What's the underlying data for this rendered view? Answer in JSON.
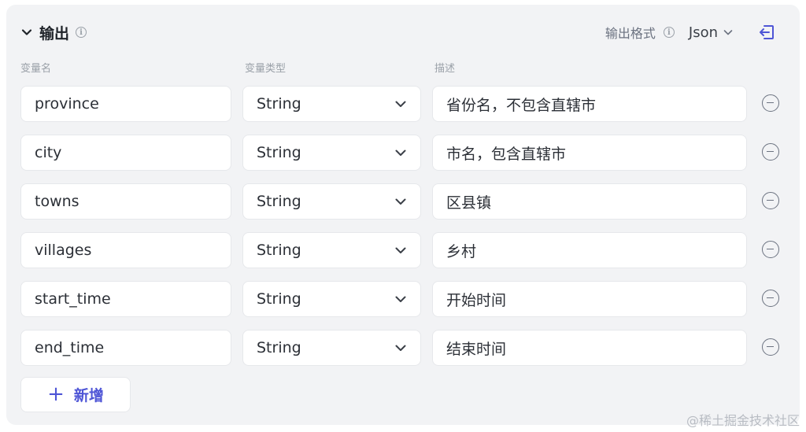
{
  "header": {
    "title": "输出",
    "format_label": "输出格式",
    "format_value": "Json"
  },
  "columns": {
    "name": "变量名",
    "type": "变量类型",
    "desc": "描述"
  },
  "rows": [
    {
      "name": "province",
      "type": "String",
      "desc": "省份名，不包含直辖市"
    },
    {
      "name": "city",
      "type": "String",
      "desc": "市名，包含直辖市"
    },
    {
      "name": "towns",
      "type": "String",
      "desc": "区县镇"
    },
    {
      "name": "villages",
      "type": "String",
      "desc": "乡村"
    },
    {
      "name": "start_time",
      "type": "String",
      "desc": "开始时间"
    },
    {
      "name": "end_time",
      "type": "String",
      "desc": "结束时间"
    }
  ],
  "add_button": {
    "label": "新增"
  },
  "watermark": "@稀土掘金技术社区",
  "colors": {
    "accent": "#4e55d6",
    "panel": "#f2f3f5"
  }
}
